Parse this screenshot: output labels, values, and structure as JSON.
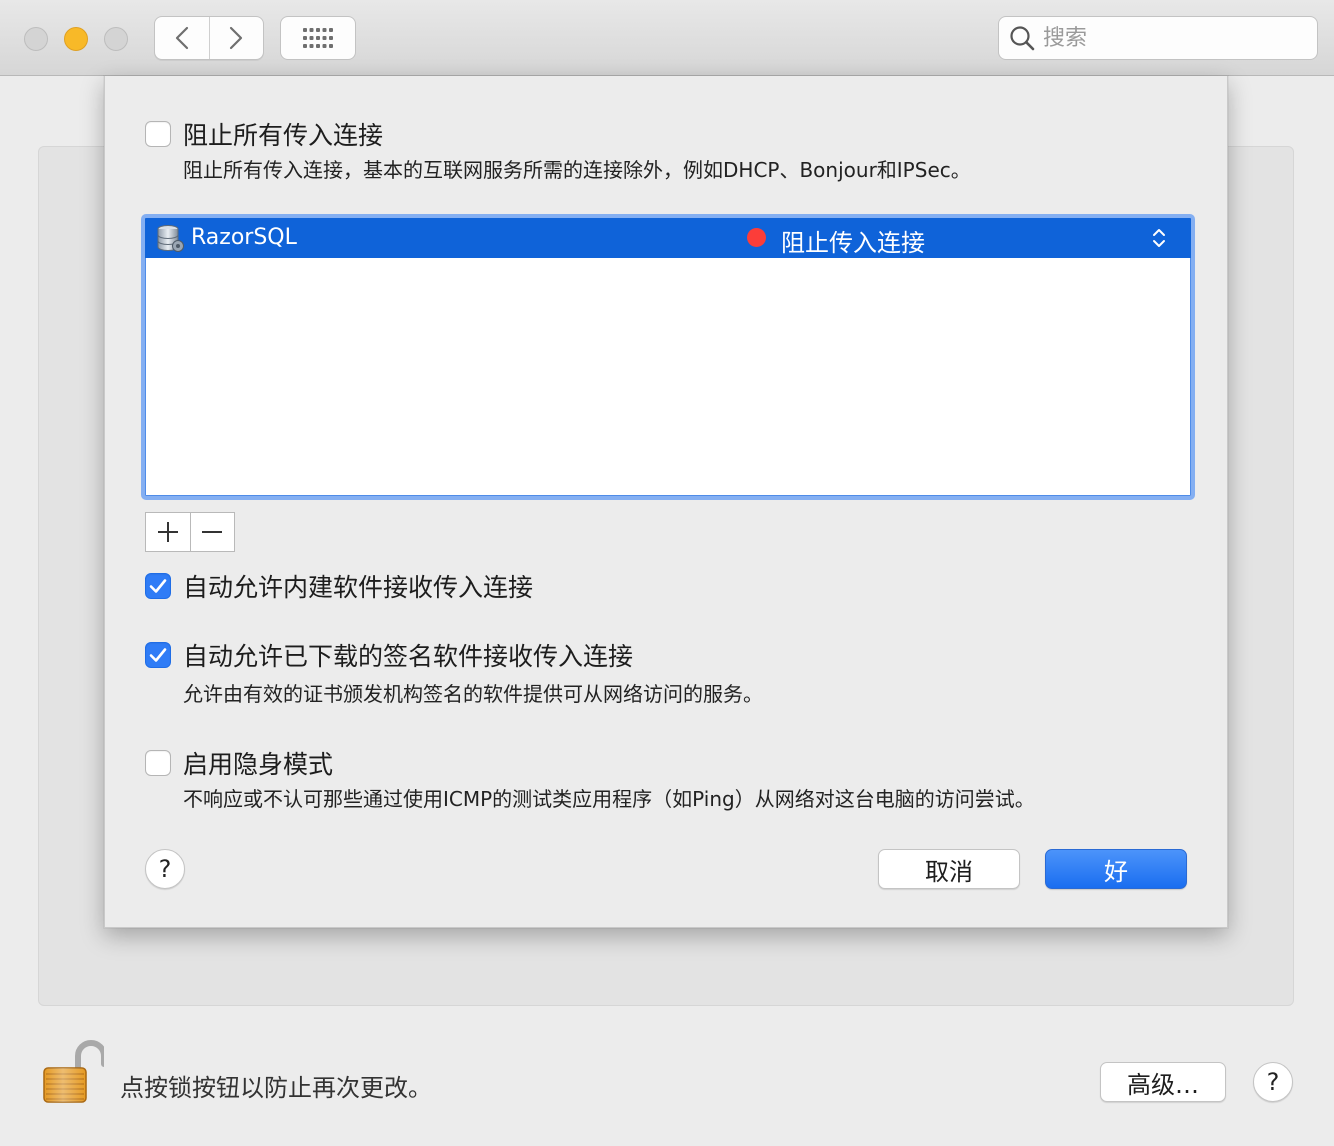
{
  "toolbar": {
    "search_placeholder": "搜索"
  },
  "firewall": {
    "block_all": {
      "label": "阻止所有传入连接",
      "description": "阻止所有传入连接，基本的互联网服务所需的连接除外，例如DHCP、Bonjour和IPSec。",
      "checked": false
    },
    "apps": [
      {
        "name": "RazorSQL",
        "status": "阻止传入连接",
        "status_color": "#fc3d39",
        "icon": "database-icon"
      }
    ],
    "add_label": "+",
    "remove_label": "−",
    "auto_builtin": {
      "label": "自动允许内建软件接收传入连接",
      "checked": true
    },
    "auto_signed": {
      "label": "自动允许已下载的签名软件接收传入连接",
      "description": "允许由有效的证书颁发机构签名的软件提供可从网络访问的服务。",
      "checked": true
    },
    "stealth": {
      "label": "启用隐身模式",
      "description": "不响应或不认可那些通过使用ICMP的测试类应用程序（如Ping）从网络对这台电脑的访问尝试。",
      "checked": false
    },
    "help_label": "?",
    "cancel_label": "取消",
    "ok_label": "好"
  },
  "footer": {
    "lock_text": "点按锁按钮以防止再次更改。",
    "advanced_label": "高级…",
    "help_label": "?"
  },
  "colors": {
    "accent": "#0f63d9",
    "checkbox_checked": "#2f7cf6"
  }
}
